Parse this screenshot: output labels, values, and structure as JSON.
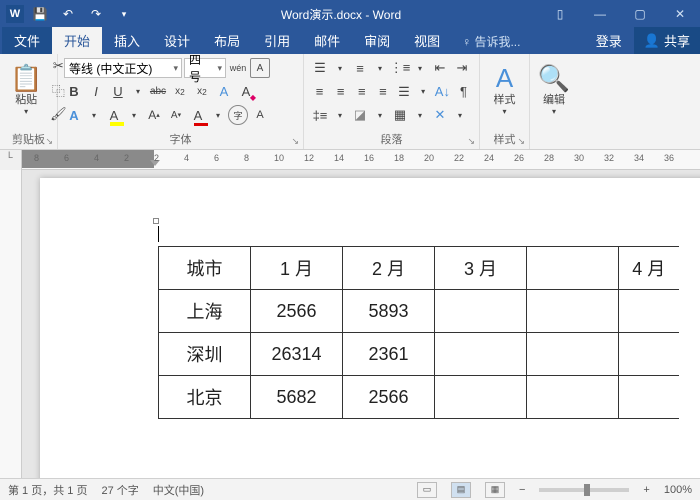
{
  "titlebar": {
    "title": "Word演示.docx - Word",
    "qat": {
      "save": "💾",
      "undo": "↶",
      "redo": "↷",
      "more": "▾"
    }
  },
  "winbtns": {
    "min": "—",
    "max": "▢",
    "close": "✕"
  },
  "tabs": {
    "file": "文件",
    "home": "开始",
    "insert": "插入",
    "design": "设计",
    "layout": "布局",
    "references": "引用",
    "mailings": "邮件",
    "review": "审阅",
    "view": "视图",
    "tell": "♀ 告诉我...",
    "account": "登录",
    "share": "共享"
  },
  "ribbon": {
    "clipboard": {
      "label": "剪贴板",
      "paste": "粘贴"
    },
    "font": {
      "label": "字体",
      "family": "等线 (中文正文)",
      "size": "四号",
      "bold": "B",
      "italic": "I",
      "underline": "U",
      "strike": "abc",
      "sub": "x₂",
      "sup": "x²",
      "clear": "A",
      "phonetic": "wén",
      "charborder": "A"
    },
    "paragraph": {
      "label": "段落"
    },
    "styles": {
      "label": "样式",
      "button": "样式"
    },
    "editing": {
      "label": "",
      "button": "编辑"
    }
  },
  "ruler": {
    "numbers": [
      8,
      6,
      4,
      2,
      2,
      4,
      6,
      8,
      10,
      12,
      14,
      16,
      18,
      20,
      22,
      24,
      26,
      28,
      30,
      32,
      34,
      36
    ]
  },
  "table": {
    "headers": [
      "城市",
      "1 月",
      "2 月",
      "3 月",
      "",
      "4 月"
    ],
    "rows": [
      [
        "上海",
        "2566",
        "5893",
        "",
        "",
        ""
      ],
      [
        "深圳",
        "26314",
        "2361",
        "",
        "",
        ""
      ],
      [
        "北京",
        "5682",
        "2566",
        "",
        "",
        ""
      ]
    ]
  },
  "statusbar": {
    "page": "第 1 页，共 1 页",
    "words": "27 个字",
    "lang": "中文(中国)",
    "zoom": "100%",
    "minus": "−",
    "plus": "+"
  }
}
